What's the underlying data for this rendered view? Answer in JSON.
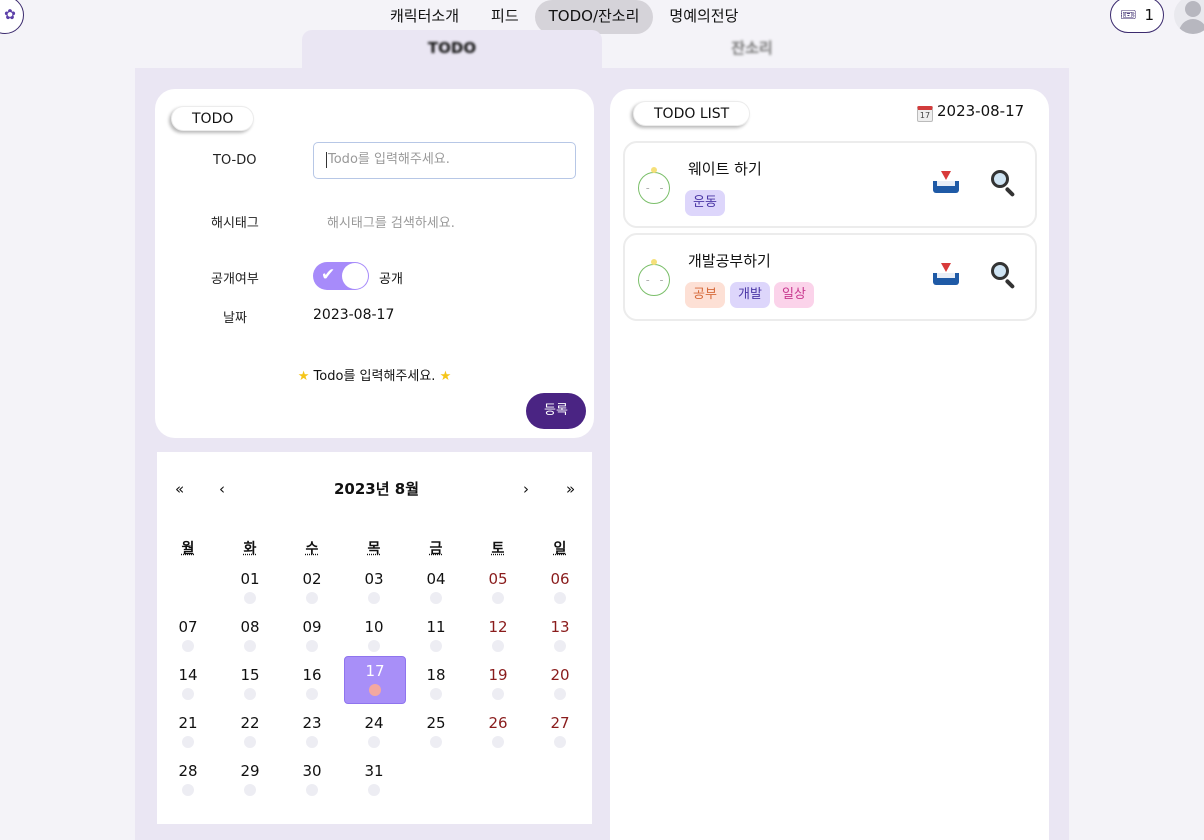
{
  "nav": {
    "items": [
      "캐릭터소개",
      "피드",
      "TODO/잔소리",
      "명예의전당"
    ],
    "active_index": 2,
    "ticket_count": "1"
  },
  "subtabs": {
    "todo": "TODO",
    "jansori": "잔소리"
  },
  "form": {
    "section_label": "TODO",
    "todo_label": "TO-DO",
    "todo_placeholder": "Todo를 입력해주세요.",
    "hashtag_label": "해시태그",
    "hashtag_placeholder": "해시태그를 검색하세요.",
    "public_label": "공개여부",
    "public_value": "공개",
    "public_on": true,
    "date_label": "날짜",
    "date_value": "2023-08-17",
    "hint": "Todo를 입력해주세요.",
    "hint_icon": "star-icon",
    "register_label": "등록"
  },
  "calendar": {
    "title": "2023년 8월",
    "nav": {
      "prev_year": "«",
      "prev_month": "‹",
      "next_month": "›",
      "next_year": "»"
    },
    "weekdays": [
      "월",
      "화",
      "수",
      "목",
      "금",
      "토",
      "일"
    ],
    "start_offset": 1,
    "days": [
      "01",
      "02",
      "03",
      "04",
      "05",
      "06",
      "07",
      "08",
      "09",
      "10",
      "11",
      "12",
      "13",
      "14",
      "15",
      "16",
      "17",
      "18",
      "19",
      "20",
      "21",
      "22",
      "23",
      "24",
      "25",
      "26",
      "27",
      "28",
      "29",
      "30",
      "31"
    ],
    "selected": "17",
    "weekend_color": "#8a1c1c",
    "selected_color": "#a88ff8"
  },
  "todo_list": {
    "label": "TODO LIST",
    "date": "2023-08-17",
    "items": [
      {
        "title": "웨이트 하기",
        "tags": [
          {
            "text": "운동",
            "color": "purple"
          }
        ]
      },
      {
        "title": "개발공부하기",
        "tags": [
          {
            "text": "공부",
            "color": "orange"
          },
          {
            "text": "개발",
            "color": "purple"
          },
          {
            "text": "일상",
            "color": "pink"
          }
        ]
      }
    ]
  },
  "colors": {
    "accent": "#4a2483",
    "toggle": "#a78bfa",
    "panel_bg": "#eae6f3"
  }
}
